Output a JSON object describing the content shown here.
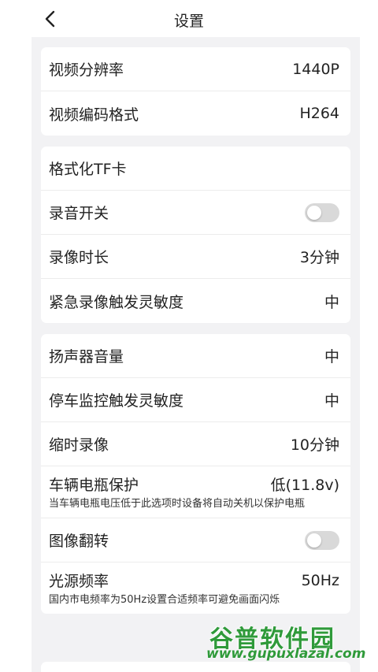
{
  "header": {
    "title": "设置"
  },
  "cards": [
    {
      "rows": [
        {
          "label": "视频分辨率",
          "value": "1440P"
        },
        {
          "label": "视频编码格式",
          "value": "H264"
        }
      ]
    },
    {
      "rows": [
        {
          "label": "格式化TF卡"
        },
        {
          "label": "录音开关",
          "toggle_on": false
        },
        {
          "label": "录像时长",
          "value": "3分钟"
        },
        {
          "label": "紧急录像触发灵敏度",
          "value": "中"
        }
      ]
    },
    {
      "rows": [
        {
          "label": "扬声器音量",
          "value": "中"
        },
        {
          "label": "停车监控触发灵敏度",
          "value": "中"
        },
        {
          "label": "缩时录像",
          "value": "10分钟"
        },
        {
          "label": "车辆电瓶保护",
          "value": "低(11.8v)",
          "desc": "当车辆电瓶电压低于此选项时设备将自动关机以保护电瓶"
        },
        {
          "label": "图像翻转",
          "toggle_on": false
        },
        {
          "label": "光源频率",
          "value": "50Hz",
          "desc": "国内市电频率为50Hz设置合适频率可避免画面闪烁"
        }
      ]
    }
  ],
  "watermark": {
    "cn": "谷普软件园",
    "url": "www.gupuxlazal.com"
  },
  "colors": {
    "background": "#f2f2f4",
    "card": "#ffffff",
    "toggle_off": "#d9d9d9",
    "watermark": "#2f9a3a"
  }
}
